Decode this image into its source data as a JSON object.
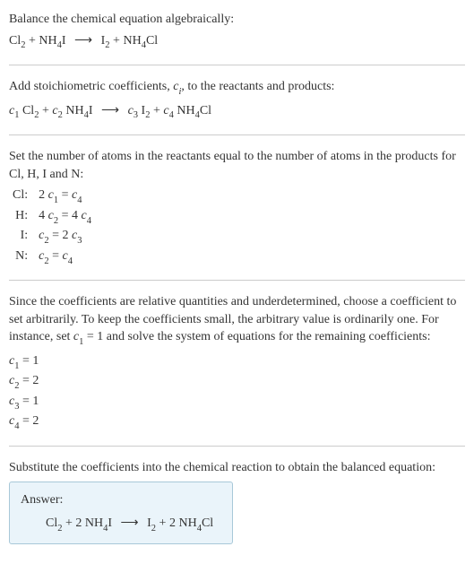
{
  "section1": {
    "prompt": "Balance the chemical equation algebraically:"
  },
  "section2": {
    "prompt": "Add stoichiometric coefficients, ",
    "prompt_var": "c",
    "prompt_sub": "i",
    "prompt_end": ", to the reactants and products:"
  },
  "section3": {
    "line1": "Set the number of atoms in the reactants equal to the number of atoms in the products for Cl, H, I and N:",
    "rows": [
      {
        "el": "Cl:",
        "lhs_coeff": "2 ",
        "lhs_var": "c",
        "lhs_sub": "1",
        "eq": " = ",
        "rhs_var": "c",
        "rhs_sub": "4",
        "rhs_coeff": ""
      },
      {
        "el": "H:",
        "lhs_coeff": "4 ",
        "lhs_var": "c",
        "lhs_sub": "2",
        "eq": " = ",
        "rhs_coeff": "4 ",
        "rhs_var": "c",
        "rhs_sub": "4"
      },
      {
        "el": "I:",
        "lhs_coeff": "",
        "lhs_var": "c",
        "lhs_sub": "2",
        "eq": " = ",
        "rhs_coeff": "2 ",
        "rhs_var": "c",
        "rhs_sub": "3"
      },
      {
        "el": "N:",
        "lhs_coeff": "",
        "lhs_var": "c",
        "lhs_sub": "2",
        "eq": " = ",
        "rhs_coeff": "",
        "rhs_var": "c",
        "rhs_sub": "4"
      }
    ]
  },
  "section4": {
    "text_a": "Since the coefficients are relative quantities and underdetermined, choose a coefficient to set arbitrarily. To keep the coefficients small, the arbitrary value is ordinarily one. For instance, set ",
    "set_var": "c",
    "set_sub": "1",
    "set_val": " = 1",
    "text_b": " and solve the system of equations for the remaining coefficients:",
    "coeffs": [
      {
        "var": "c",
        "sub": "1",
        "val": " = 1"
      },
      {
        "var": "c",
        "sub": "2",
        "val": " = 2"
      },
      {
        "var": "c",
        "sub": "3",
        "val": " = 1"
      },
      {
        "var": "c",
        "sub": "4",
        "val": " = 2"
      }
    ]
  },
  "section5": {
    "text": "Substitute the coefficients into the chemical reaction to obtain the balanced equation:",
    "answer_label": "Answer:"
  },
  "species": {
    "Cl2_a": "Cl",
    "Cl2_b": "2",
    "NH4I_a": "NH",
    "NH4I_b": "4",
    "NH4I_c": "I",
    "I2_a": "I",
    "I2_b": "2",
    "NH4Cl_a": "NH",
    "NH4Cl_b": "4",
    "NH4Cl_c": "Cl",
    "plus": " + ",
    "arrow": "⟶",
    "c": "c",
    "s1": "1",
    "s2": "2",
    "s3": "3",
    "s4": "4",
    "two": "2 "
  }
}
